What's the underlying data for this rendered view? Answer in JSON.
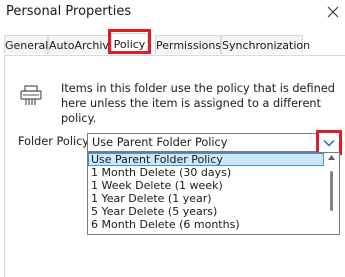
{
  "window": {
    "title": "Personal Properties"
  },
  "tabs": [
    {
      "label": "General"
    },
    {
      "label": "AutoArchive"
    },
    {
      "label": "Policy"
    },
    {
      "label": "Permissions"
    },
    {
      "label": "Synchronization"
    }
  ],
  "active_tab": "Policy",
  "info": {
    "text": "Items in this folder use the policy that is defined here unless the item is assigned to a different policy.",
    "icon": "archive-shredder-icon"
  },
  "folder_policy": {
    "label": "Folder Policy:",
    "value": "Use Parent Folder Policy",
    "options": [
      "Use Parent Folder Policy",
      "1 Month Delete (30 days)",
      "1 Week Delete (1 week)",
      "1 Year Delete (1 year)",
      "5 Year Delete (5 years)",
      "6 Month Delete (6 months)"
    ],
    "selected_index": 0
  },
  "colors": {
    "highlight_red": "#e01d26",
    "selection_bg": "#cce8ff",
    "selection_border": "#3c96e6"
  }
}
